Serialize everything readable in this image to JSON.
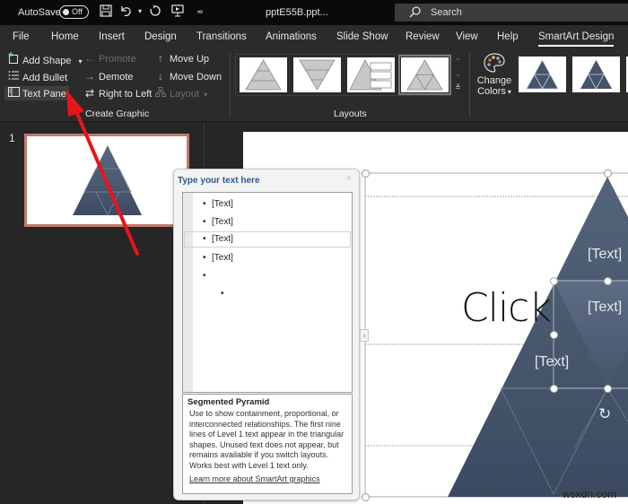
{
  "titlebar": {
    "autosave_label": "AutoSave",
    "autosave_state": "Off",
    "filename": "pptE55B.ppt...",
    "search_placeholder": "Search",
    "icons": [
      "save-icon",
      "undo-icon",
      "undo-dropdown-icon",
      "redo-icon",
      "present-icon",
      "customize-qat-icon"
    ]
  },
  "menu": {
    "tabs": [
      {
        "label": "File"
      },
      {
        "label": "Home"
      },
      {
        "label": "Insert"
      },
      {
        "label": "Design"
      },
      {
        "label": "Transitions"
      },
      {
        "label": "Animations"
      },
      {
        "label": "Slide Show"
      },
      {
        "label": "Review"
      },
      {
        "label": "View"
      },
      {
        "label": "Help"
      },
      {
        "label": "SmartArt Design",
        "active": true
      }
    ]
  },
  "ribbon": {
    "create_graphic": {
      "label": "Create Graphic",
      "add_shape": "Add Shape",
      "add_bullet": "Add Bullet",
      "text_pane": "Text Pane",
      "promote": "Promote",
      "demote": "Demote",
      "right_to_left": "Right to Left",
      "move_up": "Move Up",
      "move_down": "Move Down",
      "layout": "Layout"
    },
    "layouts": {
      "label": "Layouts",
      "items": [
        "Basic Pyramid",
        "Inverted Pyramid",
        "Pyramid List",
        "Segmented Pyramid"
      ],
      "selected": "Segmented Pyramid"
    },
    "smartart_styles": {
      "change_colors_line1": "Change",
      "change_colors_line2": "Colors"
    }
  },
  "slides_pane": {
    "slide_number": "1"
  },
  "text_pane": {
    "title": "Type your text here",
    "close": "×",
    "items": [
      {
        "text": "[Text]",
        "level": 1
      },
      {
        "text": "[Text]",
        "level": 1
      },
      {
        "text": "[Text]",
        "level": 1,
        "selected": true
      },
      {
        "text": "[Text]",
        "level": 1
      },
      {
        "text": "",
        "level": 1
      },
      {
        "text": "",
        "level": 2
      }
    ],
    "description_title": "Segmented Pyramid",
    "description_body": "Use to show containment, proportional, or interconnected relationships. The first nine lines of Level 1 text appear in the triangular shapes. Unused text does not appear, but remains available if you switch layouts. Works best with Level 1 text only.",
    "learn_more": "Learn more about SmartArt graphics",
    "expander": "›"
  },
  "slide": {
    "title_placeholder": "Click",
    "shape_labels": [
      "[Text]",
      "[Text]",
      "[Text]"
    ]
  },
  "colors": {
    "pyramid_fill": "#44546a",
    "annotation_arrow": "#e8141c",
    "slide_thumb_border": "#c0796b",
    "text_pane_title": "#2e5a8a"
  },
  "watermark": "wsxdn.com"
}
